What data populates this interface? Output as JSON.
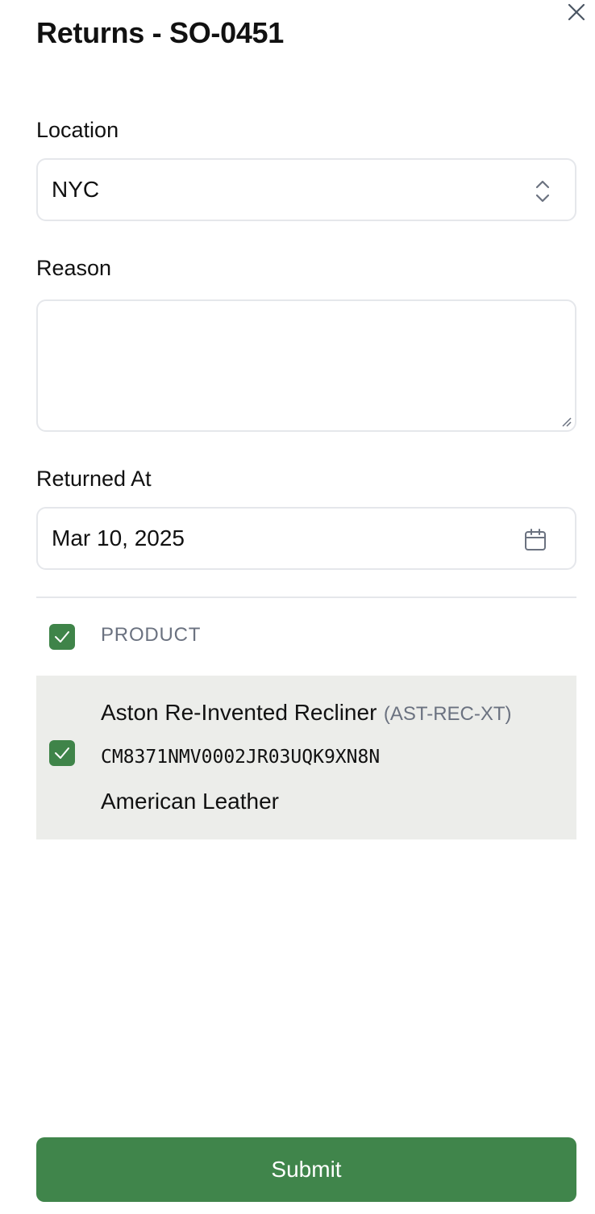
{
  "dialog": {
    "title": "Returns - SO-0451",
    "close_icon": "close-icon"
  },
  "form": {
    "location": {
      "label": "Location",
      "value": "NYC",
      "icon": "chevron-up-down-icon"
    },
    "reason": {
      "label": "Reason",
      "value": "",
      "placeholder": ""
    },
    "returned_at": {
      "label": "Returned At",
      "value": "Mar 10, 2025",
      "icon": "calendar-icon"
    }
  },
  "table": {
    "header": {
      "label": "PRODUCT",
      "select_all_checked": true
    },
    "rows": [
      {
        "checked": true,
        "product_name": "Aston Re-Invented Recliner",
        "sku": "(AST-REC-XT)",
        "serial": "CM8371NMV0002JR03UQK9XN8N",
        "material": "American Leather"
      }
    ]
  },
  "actions": {
    "submit_label": "Submit"
  },
  "colors": {
    "accent": "#40854b",
    "row_background": "#ecedea",
    "border": "#e5e7eb",
    "muted_text": "#6b7280"
  }
}
